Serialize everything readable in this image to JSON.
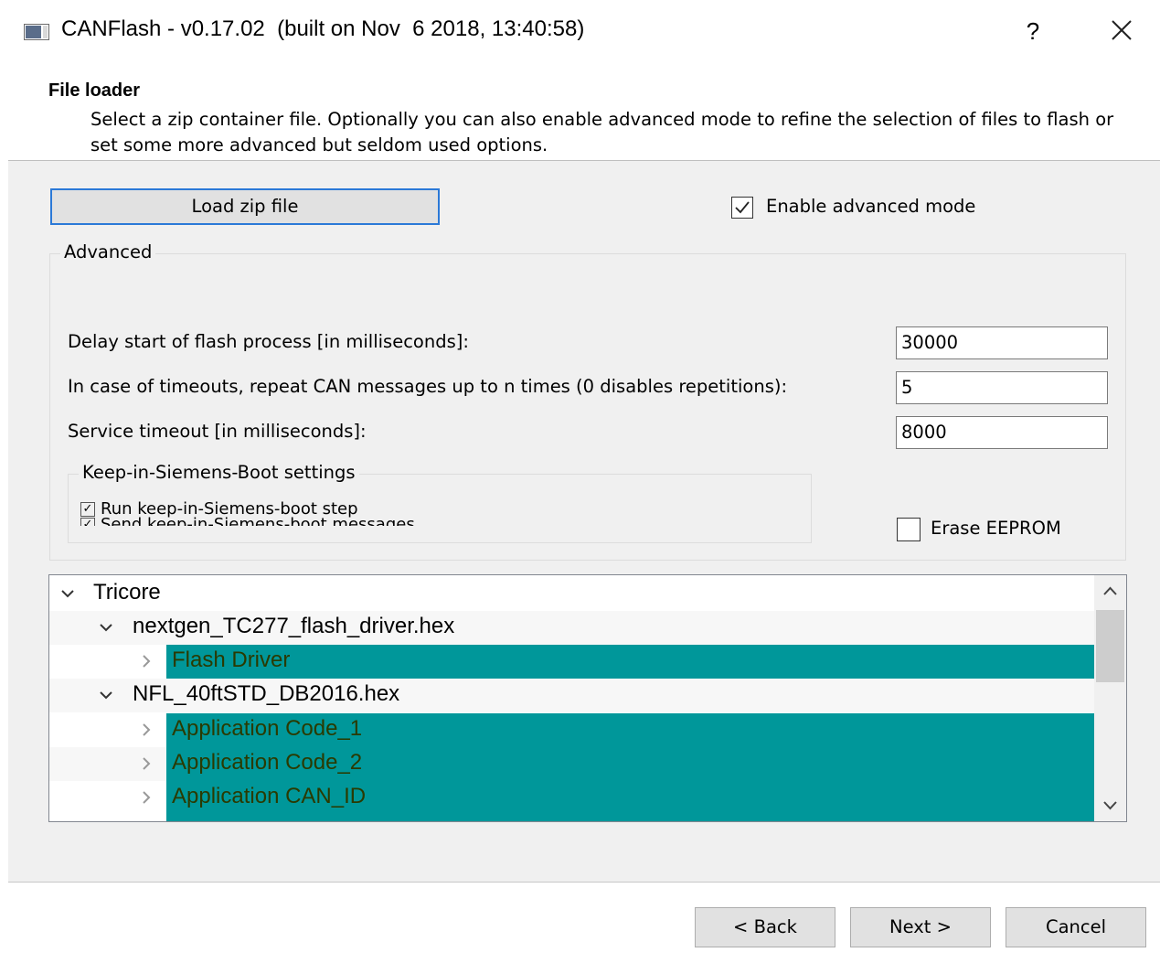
{
  "window": {
    "title": "CANFlash - v0.17.02  (built on Nov  6 2018, 13:40:58)",
    "help_label": "?",
    "icons": {
      "app": "app-window-icon",
      "close": "close-icon"
    }
  },
  "header": {
    "title": "File loader",
    "description": "Select a zip container file. Optionally you can also enable advanced mode to refine the selection of files to flash or set some more advanced but seldom used options."
  },
  "load_button": {
    "label": "Load zip file"
  },
  "advanced_mode": {
    "label": "Enable advanced mode",
    "checked": true
  },
  "advanced": {
    "title": "Advanced",
    "delay": {
      "label": "Delay start of flash process [in milliseconds]:",
      "value": "30000"
    },
    "repeat": {
      "label": "In case of timeouts, repeat CAN messages up to n times (0 disables repetitions):",
      "value": "5"
    },
    "service_timeout": {
      "label": "Service timeout [in milliseconds]:",
      "value": "8000"
    },
    "kisb": {
      "title": "Keep-in-Siemens-Boot settings",
      "items": [
        {
          "label": "Run keep-in-Siemens-boot step",
          "checked": true
        },
        {
          "label": "Send keep-in-Siemens-boot messages",
          "checked": true
        }
      ]
    },
    "erase_eeprom": {
      "label": "Erase EEPROM",
      "checked": false
    }
  },
  "tree": {
    "items": [
      {
        "label": "Tricore",
        "expanded": true,
        "selected": false
      },
      {
        "label": "nextgen_TC277_flash_driver.hex",
        "expanded": true,
        "selected": false
      },
      {
        "label": "Flash Driver",
        "expanded": false,
        "selected": true
      },
      {
        "label": "NFL_40ftSTD_DB2016.hex",
        "expanded": true,
        "selected": false
      },
      {
        "label": "Application Code_1",
        "expanded": false,
        "selected": true
      },
      {
        "label": "Application Code_2",
        "expanded": false,
        "selected": true
      },
      {
        "label": "Application CAN_ID",
        "expanded": false,
        "selected": true
      }
    ],
    "selection_color": "#00979a"
  },
  "footer": {
    "back_label": "< Back",
    "next_label": "Next >",
    "cancel_label": "Cancel"
  },
  "colors": {
    "focus_border": "#2b79d7",
    "panel_bg": "#f0f0f0"
  }
}
